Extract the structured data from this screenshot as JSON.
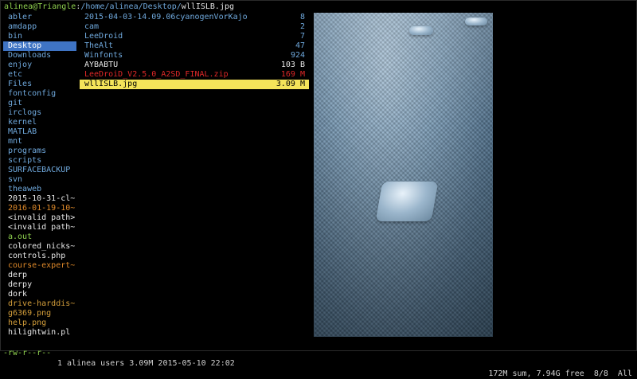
{
  "title": {
    "user_host": "alinea@Triangle",
    "sep": ":",
    "path": "/home/alinea/Desktop/",
    "file": "wllISLB.jpg"
  },
  "parent_column": [
    {
      "label": "abler",
      "kind": "dir"
    },
    {
      "label": "amdapp",
      "kind": "dir"
    },
    {
      "label": "bin",
      "kind": "dir"
    },
    {
      "label": "Desktop",
      "kind": "dir-selected"
    },
    {
      "label": "Downloads",
      "kind": "dir"
    },
    {
      "label": "enjoy",
      "kind": "dir"
    },
    {
      "label": "etc",
      "kind": "dir"
    },
    {
      "label": "Files",
      "kind": "dir"
    },
    {
      "label": "fontconfig",
      "kind": "dir"
    },
    {
      "label": "git",
      "kind": "dir"
    },
    {
      "label": "irclogs",
      "kind": "dir"
    },
    {
      "label": "kernel",
      "kind": "dir"
    },
    {
      "label": "MATLAB",
      "kind": "dir"
    },
    {
      "label": "mnt",
      "kind": "dir"
    },
    {
      "label": "programs",
      "kind": "dir"
    },
    {
      "label": "scripts",
      "kind": "dir"
    },
    {
      "label": "SURFACEBACKUP",
      "kind": "dir"
    },
    {
      "label": "svn",
      "kind": "dir"
    },
    {
      "label": "theaweb",
      "kind": "dir"
    },
    {
      "label": "2015-10-31-cl~",
      "kind": "file"
    },
    {
      "label": "2016-01-19-10~",
      "kind": "arch"
    },
    {
      "label": "<invalid path>",
      "kind": "file"
    },
    {
      "label": "<invalid path~",
      "kind": "file"
    },
    {
      "label": "a.out",
      "kind": "exec"
    },
    {
      "label": "colored_nicks~",
      "kind": "file"
    },
    {
      "label": "controls.php",
      "kind": "file"
    },
    {
      "label": "course-expert~",
      "kind": "arch"
    },
    {
      "label": "derp",
      "kind": "file"
    },
    {
      "label": "derpy",
      "kind": "file"
    },
    {
      "label": "dork",
      "kind": "file"
    },
    {
      "label": "drive-harddis~",
      "kind": "bkp"
    },
    {
      "label": "g6369.png",
      "kind": "img"
    },
    {
      "label": "help.png",
      "kind": "img"
    },
    {
      "label": "hilightwin.pl",
      "kind": "file"
    }
  ],
  "current_column": [
    {
      "name": "2015-04-03-14.09.06cyanogenVorKajo",
      "size": "8",
      "kind": "dir"
    },
    {
      "name": "cam",
      "size": "2",
      "kind": "dir"
    },
    {
      "name": "LeeDroid",
      "size": "7",
      "kind": "dir"
    },
    {
      "name": "TheAlt",
      "size": "47",
      "kind": "dir"
    },
    {
      "name": "Winfonts",
      "size": "924",
      "kind": "dir"
    },
    {
      "name": "AYBABTU",
      "size": "103 B",
      "kind": "file"
    },
    {
      "name": "LeeDroiD_V2.5.0_A2SD_FINAL.zip",
      "size": "169 M",
      "kind": "red"
    },
    {
      "name": "wllISLB.jpg",
      "size": "3.09 M",
      "kind": "cur"
    }
  ],
  "preview": {
    "description_icon": "image-preview"
  },
  "status": {
    "perm": "-rw-r--r--",
    "info": "1 alinea users 3.09M 2015-05-10 22:02",
    "right": "172M sum, 7.94G free  8/8  All"
  }
}
